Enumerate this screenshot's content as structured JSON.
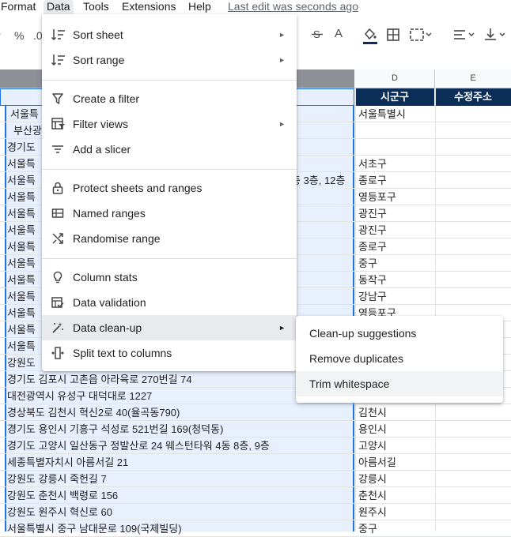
{
  "menubar": {
    "items": [
      "Format",
      "Data",
      "Tools",
      "Extensions",
      "Help"
    ],
    "last_edit": "Last edit was seconds ago"
  },
  "toolbar": {
    "percent": "%",
    "decimal": ".0",
    "text_color": "A"
  },
  "columns": {
    "d_header": "D",
    "e_header": "E"
  },
  "sheet": {
    "header_d": "시군구",
    "header_e": "수정주소",
    "col_a": [
      "서울특",
      "부산광",
      "경기도",
      "서울특",
      "서울특",
      "서울특",
      "서울특",
      "서울특",
      "서울특",
      "서울특",
      "서울특",
      "서울특",
      "서울특",
      "서울특",
      "서울특",
      "강원도",
      "경기도 김포시 고촌읍 아라육로 270번길 74",
      "대전광역시 유성구 대덕대로 1227",
      "경상북도 김천시 혁신2로 40(율곡동790)",
      "경기도 용인시 기흥구 석성로 521번길 169(청덕동)",
      "경기도 고양시 일산동구 정발산로 24 웨스턴타워 4동 8층, 9층",
      "세종특별자치시 아름서길 21",
      "강원도 강릉시 죽헌길 7",
      "강원도 춘천시 백령로 156",
      "강원도 원주시 혁신로 60",
      "서울특별시 중구 남대문로 109(국제빌딩)"
    ],
    "col_a_overflow": "층 3층, 12층",
    "col_d": [
      "서울특별시",
      "",
      "",
      "서초구",
      "종로구",
      "영등포구",
      "광진구",
      "광진구",
      "종로구",
      "중구",
      "동작구",
      "강남구",
      "영등포구",
      "",
      "",
      "",
      "",
      "",
      "김천시",
      "용인시",
      "고양시",
      "아름서길",
      "강릉시",
      "춘천시",
      "원주시",
      "중구"
    ]
  },
  "data_menu": {
    "items": [
      {
        "label": "Sort sheet",
        "icon": "sort-icon",
        "submenu": true
      },
      {
        "label": "Sort range",
        "icon": "sort-icon",
        "submenu": true
      },
      {
        "label": "Create a filter",
        "icon": "filter-icon",
        "submenu": false
      },
      {
        "label": "Filter views",
        "icon": "filter-views-icon",
        "submenu": true
      },
      {
        "label": "Add a slicer",
        "icon": "slicer-icon",
        "submenu": false
      },
      {
        "label": "Protect sheets and ranges",
        "icon": "lock-icon",
        "submenu": false
      },
      {
        "label": "Named ranges",
        "icon": "named-ranges-icon",
        "submenu": false
      },
      {
        "label": "Randomise range",
        "icon": "shuffle-icon",
        "submenu": false
      },
      {
        "label": "Column stats",
        "icon": "lightbulb-icon",
        "submenu": false
      },
      {
        "label": "Data validation",
        "icon": "data-validation-icon",
        "submenu": false
      },
      {
        "label": "Data clean-up",
        "icon": "magic-wand-icon",
        "submenu": true
      },
      {
        "label": "Split text to columns",
        "icon": "split-columns-icon",
        "submenu": false
      }
    ],
    "arrow": "►"
  },
  "cleanup_submenu": {
    "items": [
      "Clean-up suggestions",
      "Remove duplicates",
      "Trim whitespace"
    ]
  },
  "colors": {
    "header_bg": "#0b2e59",
    "selection_bg": "#e8f0fe",
    "selection_border": "#1a73e8",
    "menu_hover": "#e8eaed"
  }
}
